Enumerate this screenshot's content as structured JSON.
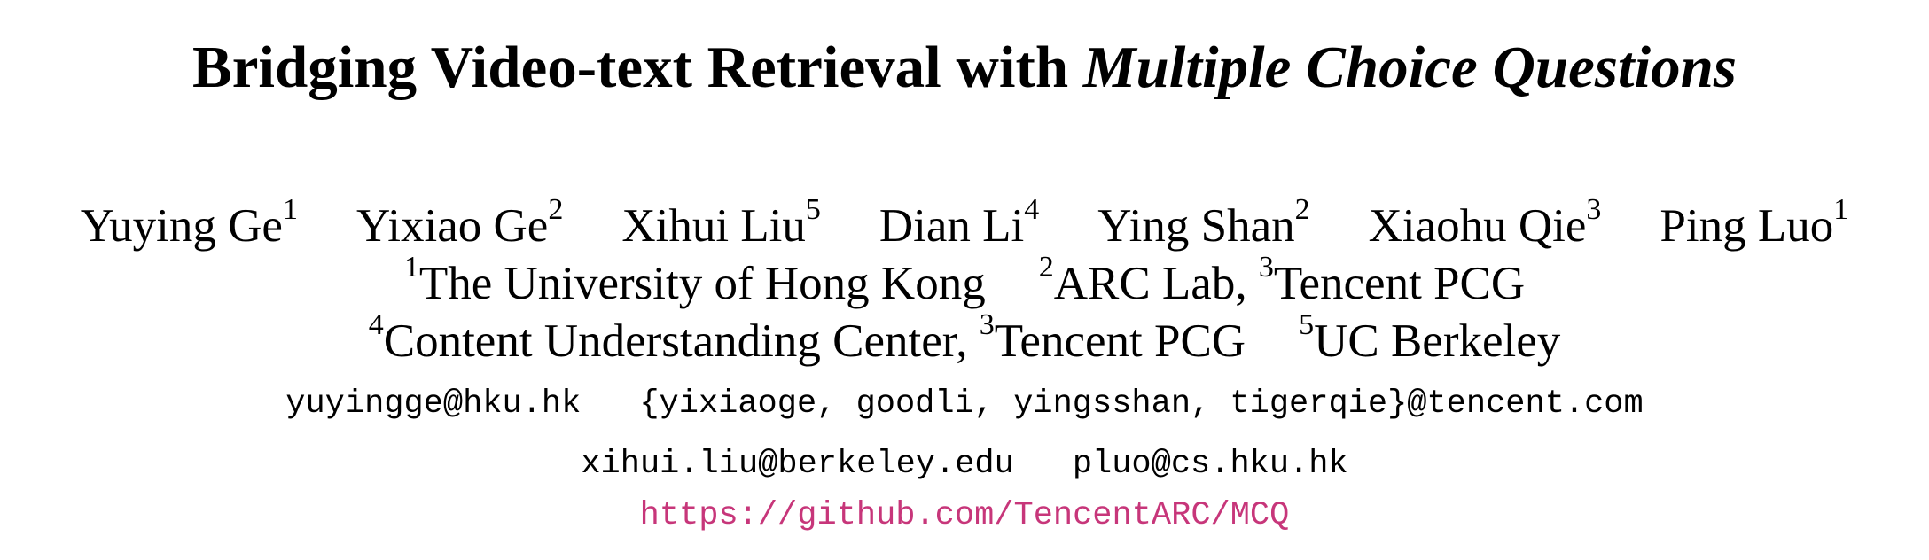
{
  "title": {
    "plain": "Bridging Video-text Retrieval with ",
    "italic": "Multiple Choice Questions"
  },
  "authors": [
    {
      "name": "Yuying Ge",
      "sup": "1"
    },
    {
      "name": "Yixiao Ge",
      "sup": "2"
    },
    {
      "name": "Xihui Liu",
      "sup": "5"
    },
    {
      "name": "Dian Li",
      "sup": "4"
    },
    {
      "name": "Ying Shan",
      "sup": "2"
    },
    {
      "name": "Xiaohu Qie",
      "sup": "3"
    },
    {
      "name": "Ping Luo",
      "sup": "1"
    }
  ],
  "affiliations": {
    "line1": [
      {
        "sup": "1",
        "text": "The University of Hong Kong"
      },
      {
        "sup": "2",
        "text": "ARC Lab, "
      },
      {
        "sup": "3",
        "text": "Tencent PCG"
      }
    ],
    "line2": [
      {
        "sup": "4",
        "text": "Content Understanding Center, "
      },
      {
        "sup": "3",
        "text": "Tencent PCG"
      },
      {
        "sup": "5",
        "text": "UC Berkeley"
      }
    ]
  },
  "emails": {
    "line1": [
      "yuyingge@hku.hk",
      "{yixiaoge, goodli, yingsshan, tigerqie}@tencent.com"
    ],
    "line2": [
      "xihui.liu@berkeley.edu",
      "pluo@cs.hku.hk"
    ]
  },
  "url": "https://github.com/TencentARC/MCQ",
  "colors": {
    "link": "#c7367a",
    "text": "#000000",
    "background": "#ffffff"
  }
}
